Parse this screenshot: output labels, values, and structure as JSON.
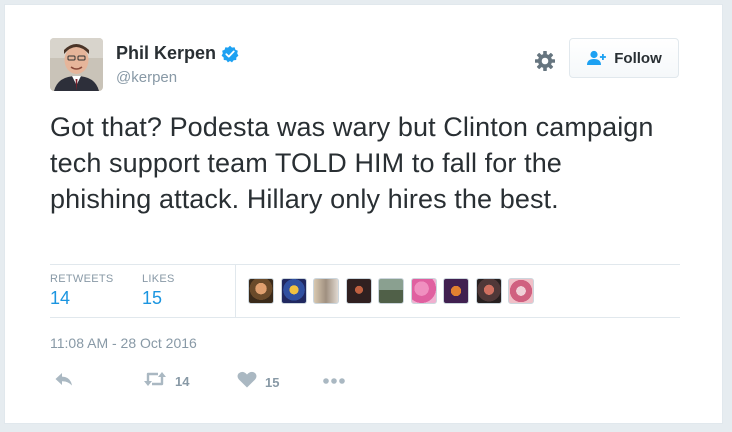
{
  "tweet": {
    "author_name": "Phil Kerpen",
    "handle": "@kerpen",
    "follow_label": "Follow",
    "text": "Got that? Podesta was wary but Clinton campaign tech support team TOLD HIM to fall for the phishing attack. Hillary only hires the best.",
    "timestamp": "11:08 AM - 28 Oct 2016"
  },
  "stats": {
    "retweets_label": "RETWEETS",
    "retweets_value": "14",
    "likes_label": "LIKES",
    "likes_value": "15"
  },
  "actions": {
    "retweet_count": "14",
    "like_count": "15"
  },
  "colors": {
    "accent": "#1b95e0",
    "muted": "#8899a6",
    "verified": "#1da1f2",
    "border": "#e1e8ed"
  }
}
